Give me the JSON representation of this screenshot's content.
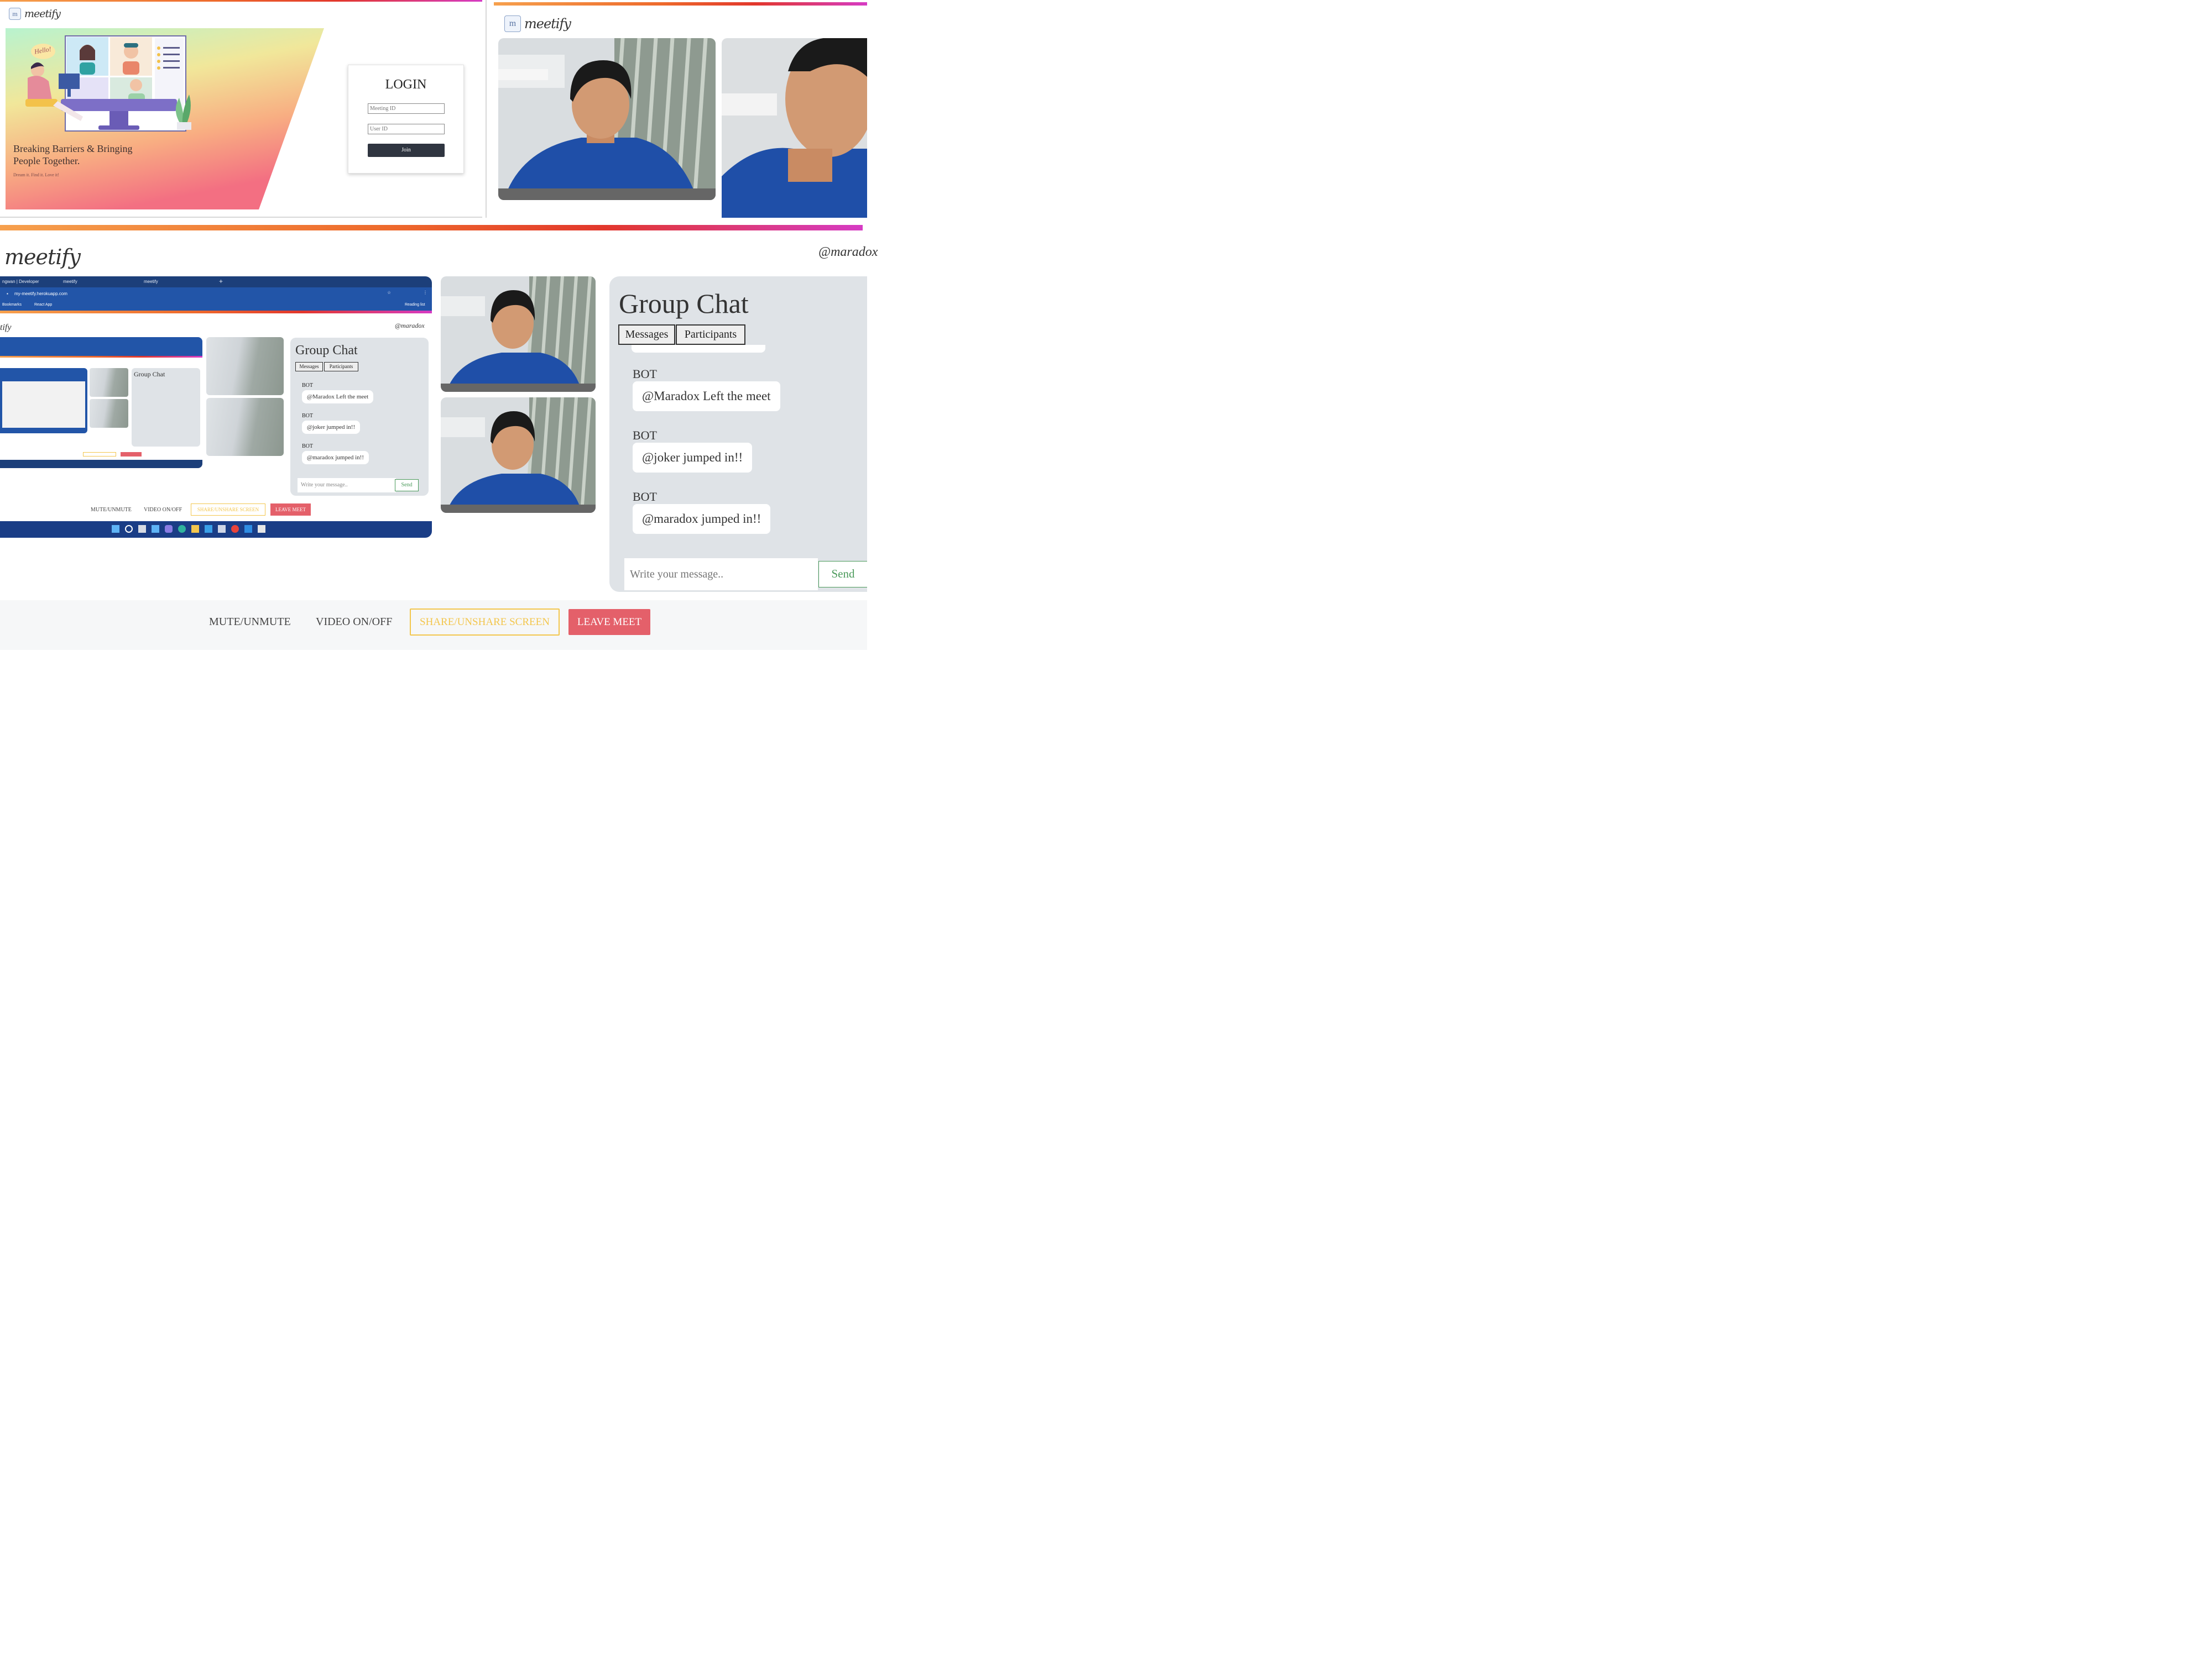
{
  "brand": {
    "name": "meetify"
  },
  "colors": {
    "accent_gradient": [
      "#f6a04d",
      "#ee6a2c",
      "#e2372c",
      "#d63bc4"
    ],
    "join_button": "#2f3540",
    "leave_button": "#e4606a",
    "share_button_text": "#f3c64d",
    "chat_panel": "#dfe3e7",
    "send_green": "#4a9a5a"
  },
  "landing": {
    "hello_bubble": "Hello!",
    "tagline": "Breaking Barriers & Bringing People Together.",
    "subtagline": "Dream it. Find it. Love it!"
  },
  "login": {
    "title": "LOGIN",
    "meeting_id_placeholder": "Meeting ID",
    "user_id_placeholder": "User ID",
    "join_label": "Join"
  },
  "meeting": {
    "username": "@maradox",
    "chat": {
      "title": "Group Chat",
      "tabs": [
        "Messages",
        "Participants"
      ],
      "messages": [
        {
          "sender": "BOT",
          "text": "@Maradox Left the meet"
        },
        {
          "sender": "BOT",
          "text": "@joker jumped in!!"
        },
        {
          "sender": "BOT",
          "text": "@maradox jumped in!!"
        }
      ],
      "input_placeholder": "Write your message..",
      "send_label": "Send"
    },
    "controls": {
      "mute": "MUTE/UNMUTE",
      "video": "VIDEO ON/OFF",
      "share": "SHARE/UNSHARE SCREEN",
      "leave": "LEAVE MEET"
    },
    "browser": {
      "tab1": "ngwan | Developer",
      "tab2": "meetify",
      "tab3": "meetify",
      "url": "my-meetify.herokuapp.com",
      "bookmarks": "Bookmarks",
      "bookmark_item": "React App",
      "reading_list": "Reading list"
    }
  }
}
